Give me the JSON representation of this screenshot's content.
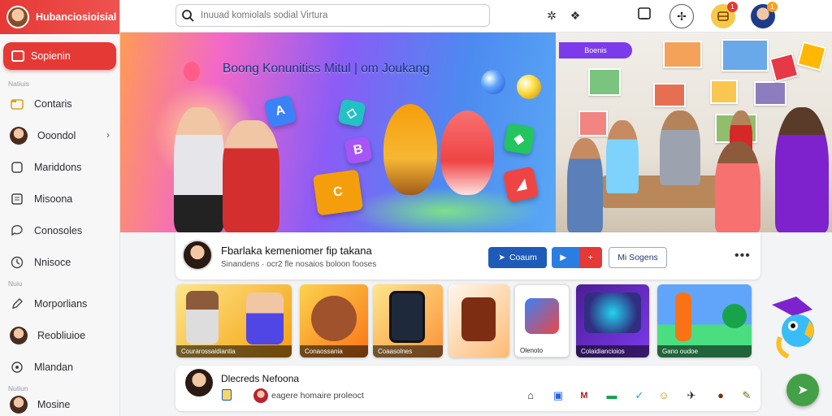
{
  "app": {
    "brand": "Hubanciosioisial",
    "logo_icon": "avatar-logo"
  },
  "sidebar": {
    "active": {
      "label": "Sopienin",
      "icon": "home-icon"
    },
    "sections": [
      "Natiuis",
      "Nuiu",
      "Nutiun"
    ],
    "items": [
      {
        "label": "Contaris",
        "icon": "folder-icon"
      },
      {
        "label": "Ooondol",
        "icon": "avatar",
        "chevron": true
      },
      {
        "label": "Mariddons",
        "icon": "tablet-icon"
      },
      {
        "label": "Misoona",
        "icon": "doc-icon"
      },
      {
        "label": "Conosoles",
        "icon": "chat-icon"
      },
      {
        "label": "Nnisoce",
        "icon": "clock-icon"
      },
      {
        "label": "Morporlians",
        "icon": "pencil-icon"
      },
      {
        "label": "Reobliuioe",
        "icon": "avatar"
      },
      {
        "label": "Mlandan",
        "icon": "settings-icon"
      },
      {
        "label": "Mosine",
        "icon": "avatar"
      }
    ]
  },
  "topbar": {
    "search_placeholder": "Inuuad komiolals sodial Virtura",
    "icons": [
      "puzzle-icon",
      "share-icon",
      "bookmark-icon",
      "controller-icon",
      "notification-icon",
      "profile-avatar"
    ],
    "notification_count": "1",
    "profile_count": "1"
  },
  "hero": {
    "title": "Boong Konunitiss Mitul | om Joukang"
  },
  "photo": {
    "tag": "Boenis"
  },
  "channel": {
    "name": "Fbarlaka kemeniomer fip takana",
    "subtitle": "Sinandens · ocr2 fle nosaios boloon fooses",
    "btn_primary": "Coaum",
    "btn_secondary": "Mi Sogens"
  },
  "thumbnails": [
    {
      "caption": "Courarossaidiantia"
    },
    {
      "caption": "Conaossania"
    },
    {
      "caption": "Coaasolnes"
    },
    {
      "caption": ""
    },
    {
      "caption": "Olenoto"
    },
    {
      "caption": "Colaidiancioios"
    },
    {
      "caption": "Gano oudoe"
    }
  ],
  "bottom": {
    "name": "Dlecreds Nefoona",
    "text": "eagere homaire proleoct"
  },
  "colors": {
    "accent": "#e53935",
    "primary": "#1e5bb8",
    "fab": "#43a047"
  }
}
